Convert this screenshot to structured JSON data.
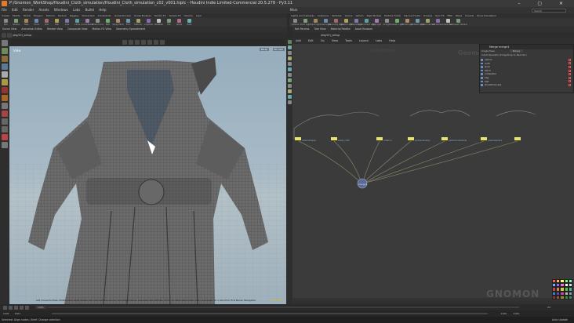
{
  "window": {
    "title": "P:/Gnomon_WorkShop/Houdini_Cloth_simulation/Houdini_Cloth_simulation_c02_v001.hiplc - Houdini Indie Limited-Commercial 20.5.278 - Py3.11"
  },
  "menu": [
    "File",
    "Edit",
    "Render",
    "Assets",
    "Windows",
    "Labs",
    "Bullet",
    "Help"
  ],
  "desktop": "Main",
  "search": {
    "placeholder": "Search"
  },
  "shelf_left": {
    "tabs": [
      "Create",
      "Modify",
      "Model",
      "Polygon",
      "Deform",
      "Texture",
      "Rigging",
      "Characters",
      "Constraints",
      "Guide Process",
      "Guide Brushes",
      "Terrain FX",
      "Simple FX",
      "Volume",
      "Lops"
    ],
    "tools": [
      "Box",
      "Sphere",
      "Tube",
      "Torus",
      "Grid",
      "Null",
      "Line",
      "Circle",
      "Curve Bezier",
      "Draw Curve",
      "Path",
      "Spray Paint",
      "Font",
      "Platonic",
      "L-System",
      "Metaball",
      "File",
      "Spiral",
      "Helix"
    ]
  },
  "shelf_right": {
    "tabs": [
      "Lights and Cameras",
      "Collisions",
      "Particles",
      "Grains",
      "Vellum",
      "Rigid Bodies",
      "Particle Fluids",
      "Viscous Fluids",
      "Oceans",
      "Pyro FX",
      "FEM",
      "Wires",
      "Crowds",
      "Drive Simulation"
    ],
    "tools": [
      "Camera",
      "Point Light",
      "Spot Light",
      "Area Light",
      "Geometry Light",
      "Volume Light",
      "Distant Light",
      "Environment Light",
      "Sky Light",
      "GI Light",
      "Caustic Light",
      "Portal Light",
      "Ambient Light",
      "Stereo Camera",
      "VR Camera",
      "Switcher",
      "Gamepad Camera"
    ]
  },
  "left_panetabs": [
    "Scene View",
    "Animation Editor",
    "Render View",
    "Composite View",
    "Motion FX View",
    "Geometry Spreadsheet"
  ],
  "right_panetabs": [
    "Net Params",
    "Tree View",
    "Material Palette",
    "Asset Browser"
  ],
  "path_left": "/obj/CH_setup",
  "path_right": "/obj/CH_setup",
  "viewport": {
    "label": "View",
    "persp": "Persp",
    "camera": "No cam",
    "status": "Left mouse tumbles. Middle pans. Right dollies. Ctrl+Alt+Left box-zooms. Ctrl+Right zooms. Spacebar-Ctrl-Left tilts. Hold L for alternate tumble, dolly, and zoom.   M or Alt+M for First Person Navigation.",
    "tag": "Indie Edition"
  },
  "network_menu": [
    "Add",
    "Edit",
    "Go",
    "View",
    "Tools",
    "Layout",
    "Labs",
    "Help"
  ],
  "network": {
    "context": "Geometry",
    "ghost": "Indie Edition",
    "nodes": [
      "vellumdrape1",
      "setup_cloth",
      "collision",
      "pintoanimation",
      "vellumconstraints",
      "vellumsolver1"
    ],
    "merge": "merge1"
  },
  "params": {
    "title": "Merge  merge1",
    "single": "Input Operator (Drag/Drop to Reorder)",
    "num_label": "Single Pass",
    "num_val": "Merge",
    "items": [
      "vellum",
      "cloth",
      "shell",
      "stitch",
      "collapsible",
      "bag",
      "belt",
      "shoesthickness"
    ]
  },
  "timeline": {
    "frame": "1001",
    "start": "1001",
    "end": "1100",
    "fps": "24",
    "end2": "1100"
  },
  "statusbar": {
    "left": "Selected: Align nodes | Brief: Change selection",
    "right": "Auto Update"
  },
  "colors": {
    "accent": "#e8782a",
    "yellow": "#d6c200",
    "node": "#e9e36a",
    "bg": "#3b3b3b"
  }
}
